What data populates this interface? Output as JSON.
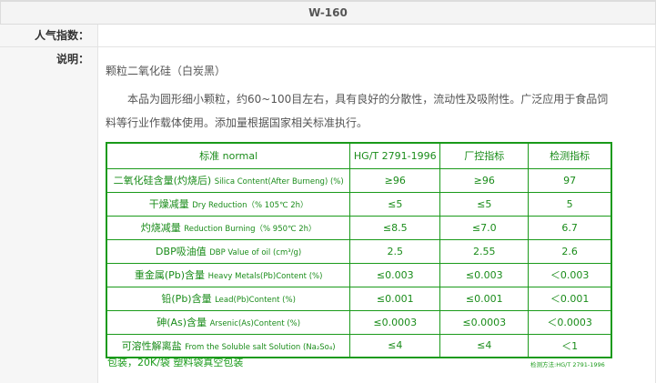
{
  "header": {
    "title": "W-160"
  },
  "popularity": {
    "label": "人气指数：",
    "value": ""
  },
  "description": {
    "label": "说明：",
    "product_name": "颗粒二氧化硅（白炭黑）",
    "intro": "本品为圆形细小颗粒，约60~100目左右，具有良好的分散性，流动性及吸附性。广泛应用于食品饲料等行业作载体使用。添加量根据国家相关标准执行。"
  },
  "spec_table": {
    "header": [
      "标准 normal",
      "HG/T 2791-1996",
      "厂控指标",
      "检测指标"
    ],
    "rows": [
      {
        "name": "二氧化硅含量(灼烧后)",
        "name_en": "Silica Content(After Burneng) (%)",
        "std": "≥96",
        "ctrl": "≥96",
        "test": "97"
      },
      {
        "name": "干燥减量",
        "name_en": "Dry Reduction（% 105℃ 2h）",
        "std": "≤5",
        "ctrl": "≤5",
        "test": "5"
      },
      {
        "name": "灼烧减量",
        "name_en": "Reduction Burning（% 950℃ 2h）",
        "std": "≤8.5",
        "ctrl": "≤7.0",
        "test": "6.7"
      },
      {
        "name": "DBP吸油值",
        "name_en": "DBP Value of oil (cm³/g)",
        "std": "2.5",
        "ctrl": "2.55",
        "test": "2.6"
      },
      {
        "name": "重金属(Pb)含量",
        "name_en": "Heavy Metals(Pb)Content (%)",
        "std": "≤0.003",
        "ctrl": "≤0.003",
        "test": "＜0.003"
      },
      {
        "name": "铅(Pb)含量",
        "name_en": "Lead(Pb)Content (%)",
        "std": "≤0.001",
        "ctrl": "≤0.001",
        "test": "＜0.001"
      },
      {
        "name": "砷(As)含量",
        "name_en": "Arsenic(As)Content (%)",
        "std": "≤0.0003",
        "ctrl": "≤0.0003",
        "test": "＜0.0003"
      },
      {
        "name": "可溶性解离盐",
        "name_en": "From the Soluble salt Solution (Na₂So₄)",
        "std": "≤4",
        "ctrl": "≤4",
        "test": "＜1"
      }
    ]
  },
  "packaging": "包装，20K/袋 塑料袋真空包装",
  "test_method": "检测方法:HG/T 2791-1996"
}
